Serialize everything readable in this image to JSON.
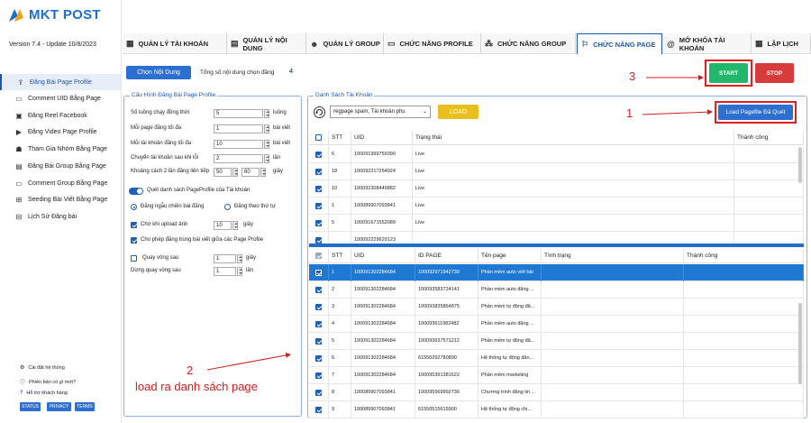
{
  "app": {
    "brand": "MKT POST",
    "version": "Version  7.4  - Update  10/8/2023"
  },
  "sidebar": {
    "items": [
      {
        "label": "Đăng Bài Page Profile",
        "icon": "upload-icon"
      },
      {
        "label": "Comment UID Bằng Page",
        "icon": "comment-icon"
      },
      {
        "label": "Đăng Reel Facebook",
        "icon": "reel-icon"
      },
      {
        "label": "Đăng Video Page Profile",
        "icon": "video-icon"
      },
      {
        "label": "Tham Gia Nhóm Bằng Page",
        "icon": "join-group-icon"
      },
      {
        "label": "Đăng Bài Group Bằng Page",
        "icon": "group-post-icon"
      },
      {
        "label": "Comment Group Bằng Page",
        "icon": "comment-group-icon"
      },
      {
        "label": "Seeding Bài Viết Bằng Page",
        "icon": "seeding-icon"
      },
      {
        "label": "Lịch Sử Đăng bài",
        "icon": "history-icon"
      }
    ],
    "footer": [
      {
        "label": "Cài đặt hệ thống",
        "icon": "gear-icon"
      },
      {
        "label": "Phiên bản có gì mới?",
        "icon": "info-icon"
      },
      {
        "label": "Hỗ trợ khách hàng",
        "icon": "help-icon"
      }
    ],
    "badges": [
      "STATUS",
      "PRIVACY",
      "TERMS"
    ]
  },
  "tabs": [
    {
      "label": "QUẢN LÝ TÀI KHOẢN",
      "icon": "account-icon"
    },
    {
      "label": "QUẢN LÝ NỘI DUNG",
      "icon": "content-icon"
    },
    {
      "label": "QUẢN LÝ GROUP",
      "icon": "group-icon"
    },
    {
      "label": "CHỨC NĂNG PROFILE",
      "icon": "profile-icon"
    },
    {
      "label": "CHỨC NĂNG GROUP",
      "icon": "network-icon"
    },
    {
      "label": "CHỨC NĂNG PAGE",
      "icon": "flag-icon"
    },
    {
      "label": "MỞ KHÓA TÀI KHOẢN",
      "icon": "at-icon"
    },
    {
      "label": "LẬP LỊCH",
      "icon": "calendar-icon"
    }
  ],
  "toolbar": {
    "choose_content": "Chọn Nội Dung",
    "total_label": "Tổng số nội dung chọn đăng",
    "total_value": "4",
    "start": "START",
    "stop": "STOP"
  },
  "config": {
    "title": "Cấu Hình Đăng Bài Page Profile",
    "fields": [
      {
        "label": "Số luồng chạy đồng thời",
        "value": "5",
        "unit": "luồng"
      },
      {
        "label": "Mỗi page đăng tối đa",
        "value": "1",
        "unit": "bài viết"
      },
      {
        "label": "Mỗi tài khoản đăng tối đa",
        "value": "10",
        "unit": "bài viết"
      },
      {
        "label": "Chuyển tài khoản sau khi lỗi",
        "value": "2",
        "unit": "lần"
      }
    ],
    "delay_label": "Khoảng cách 2 lần đăng liên tiếp",
    "delay_from": "50",
    "delay_to": "60",
    "delay_unit": "giây",
    "scan_toggle": "Quét danh sách PageProfile của Tài khoản",
    "radio_random": "Đăng ngẫu nhiên bài đăng",
    "radio_order": "Đăng theo thứ tự",
    "wait_upload": "Chờ khi upload ảnh",
    "wait_value": "10",
    "wait_unit": "giây",
    "allow_dup": "Cho phép đăng trùng bài viết giữa các Page Profile",
    "loop_after": "Quay vòng sau",
    "loop_value": "1",
    "loop_unit": "giây",
    "stop_after": "Dừng quay vòng sau",
    "stop_value": "1",
    "stop_unit": "lần"
  },
  "accounts": {
    "title": "Danh Sách Tài Khoản",
    "filter": "regpage spam, Tài khoản phụ",
    "load": "LOAD",
    "load_pagefile": "Load Pagefile Đã Quét",
    "columns": [
      "STT",
      "UID",
      "Trạng thái",
      "Thành công"
    ],
    "rows": [
      [
        "6",
        "100091999759390",
        "Live",
        ""
      ],
      [
        "18",
        "100092217254924",
        "Live",
        ""
      ],
      [
        "10",
        "100092308449882",
        "Live",
        ""
      ],
      [
        "1",
        "100089907093841",
        "Live",
        ""
      ],
      [
        "5",
        "100091671552089",
        "Live",
        ""
      ],
      [
        "",
        "100092229629123",
        "",
        ""
      ]
    ]
  },
  "pages": {
    "columns": [
      "STT",
      "UID",
      "ID PAGE",
      "Tên page",
      "Tình trạng",
      "Thành công"
    ],
    "rows": [
      [
        "1",
        "100091302284684",
        "100092971942739",
        "Phần mềm auto viết bài",
        "",
        ""
      ],
      [
        "2",
        "100091302284684",
        "100093583724141",
        "Phần mềm auto đăng ...",
        "",
        ""
      ],
      [
        "3",
        "100091302284684",
        "100093835864875",
        "Phần mềm tự động đă...",
        "",
        ""
      ],
      [
        "4",
        "100091302284684",
        "100093611982482",
        "Phần mềm auto đăng ...",
        "",
        ""
      ],
      [
        "5",
        "100091302284684",
        "100093637571212",
        "Phần mềm tự động đă...",
        "",
        ""
      ],
      [
        "6",
        "100091302284684",
        "61550292780890",
        "Hệ thống tự động đăn...",
        "",
        ""
      ],
      [
        "7",
        "100091302284684",
        "100095391381622",
        "Phần mềm marketing",
        "",
        ""
      ],
      [
        "8",
        "100089907093841",
        "100095569992736",
        "Chương trình đăng tin ...",
        "",
        ""
      ],
      [
        "9",
        "100089907093841",
        "61550515615900",
        "Hệ thống tự động chi...",
        "",
        ""
      ]
    ]
  },
  "annotations": {
    "one": "1",
    "two": "2",
    "two_text": "load ra danh sách page",
    "three": "3"
  }
}
